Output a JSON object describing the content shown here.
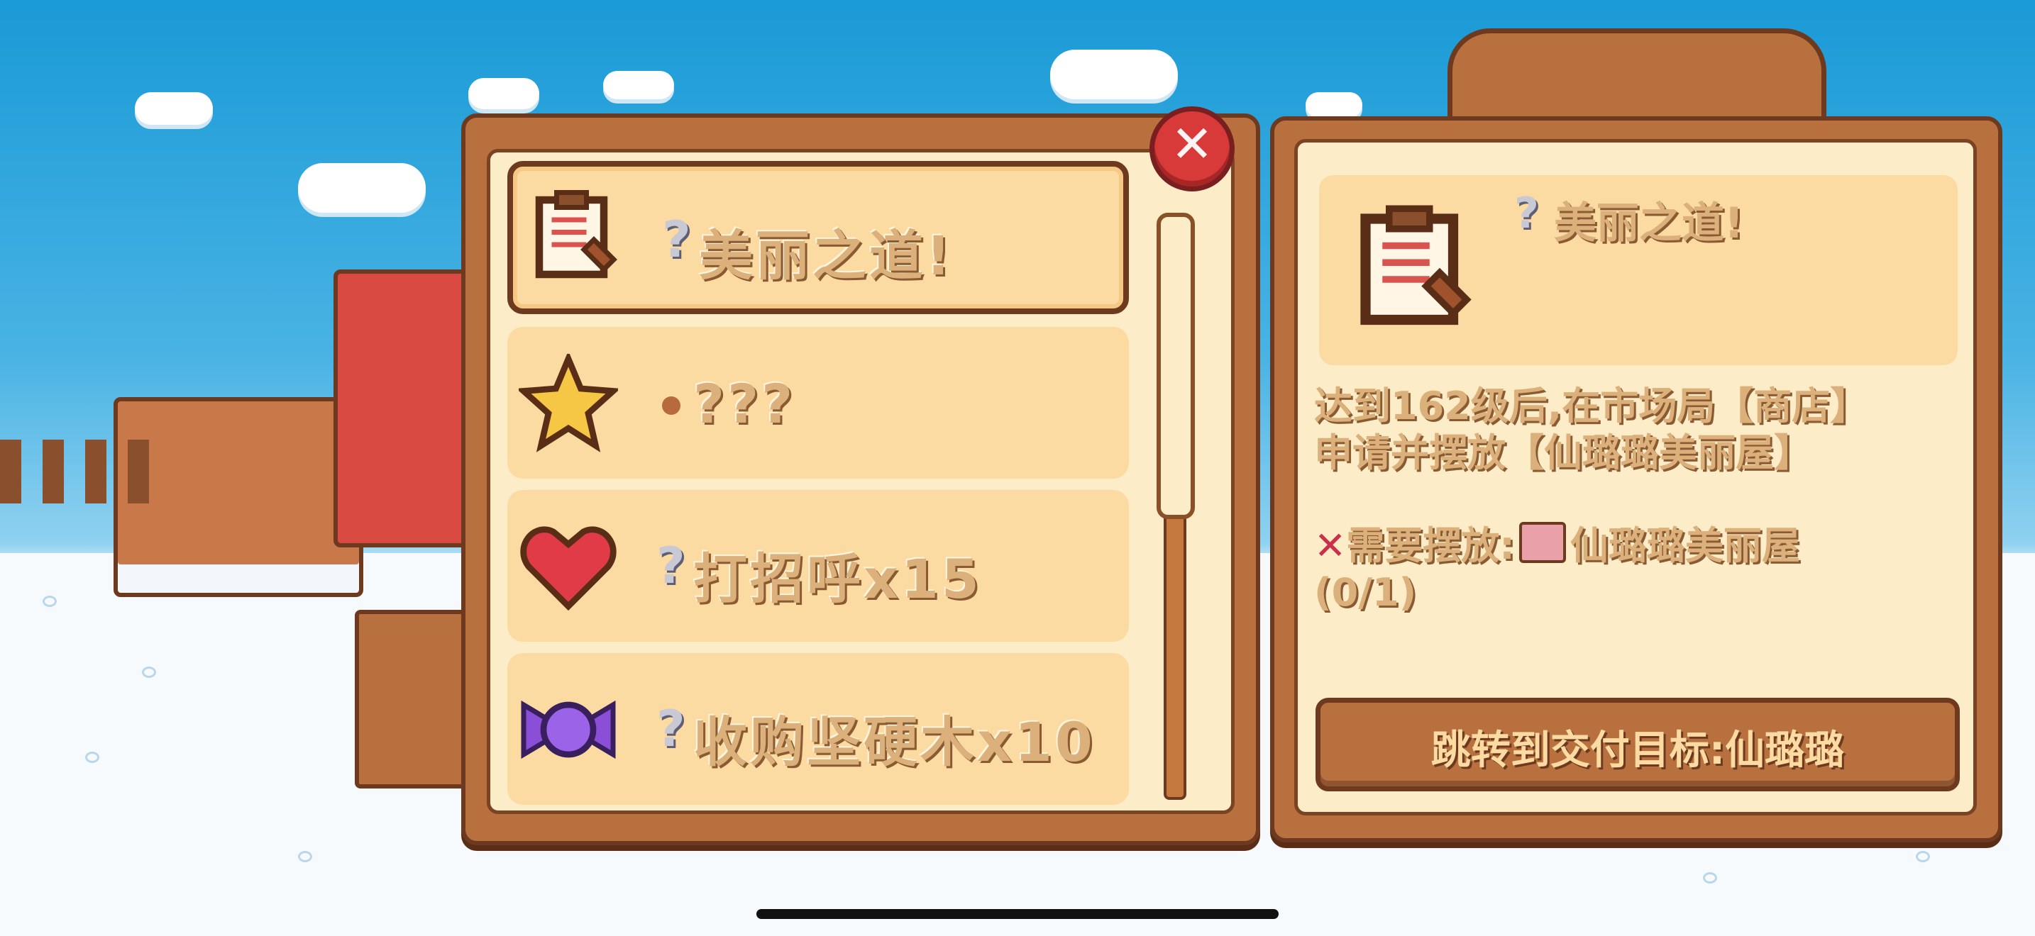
{
  "quest_list": {
    "items": [
      {
        "icon": "clipboard-icon",
        "label": "美丽之道!",
        "status": "unknown",
        "selected": true
      },
      {
        "icon": "star-icon",
        "label": "???",
        "status": "pending"
      },
      {
        "icon": "heart-icon",
        "label": "打招呼x15",
        "status": "unknown"
      },
      {
        "icon": "candy-icon",
        "label": "收购坚硬木x10",
        "status": "unknown"
      }
    ]
  },
  "detail": {
    "icon": "clipboard-icon",
    "title": "美丽之道!",
    "description": "达到162级后,在市场局【商店】申请并摆放【仙璐璐美丽屋】",
    "requirement_mark": "✕",
    "requirement_text": "需要摆放:",
    "requirement_item": "仙璐璐美丽屋",
    "requirement_progress": "(0/1)",
    "jump_button": "跳转到交付目标:仙璐璐"
  },
  "close_button": "✕",
  "question_mark": "?",
  "colors": {
    "panel_wood": "#b8703f",
    "panel_border": "#6e3a1f",
    "card_bg": "#fbdba2",
    "text_tan": "#dcb07a",
    "close_red": "#d83a3a"
  }
}
